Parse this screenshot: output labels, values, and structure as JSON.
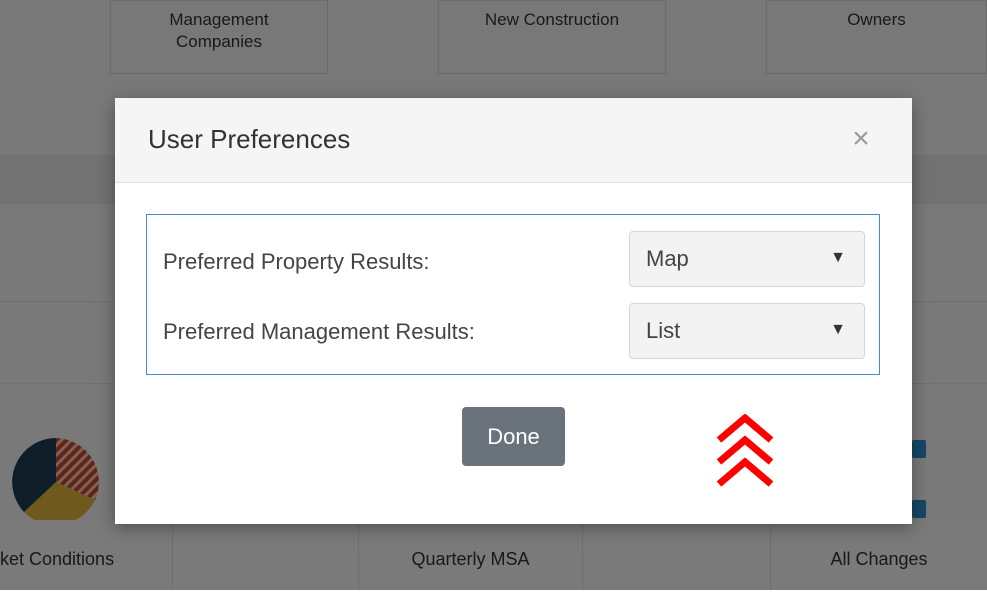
{
  "background": {
    "top_tiles": [
      {
        "line1": "Management",
        "line2": "Companies"
      },
      {
        "line1": "New Construction",
        "line2": ""
      },
      {
        "line1": "Owners",
        "line2": ""
      }
    ],
    "bottom_tiles": [
      "ket Conditions",
      "Quarterly MSA",
      "All Changes"
    ],
    "icons": {
      "pie": "pie-chart-icon",
      "app": "app-icon"
    }
  },
  "modal": {
    "title": "User Preferences",
    "close_symbol": "×",
    "preferences": [
      {
        "label": "Preferred Property Results:",
        "value": "Map"
      },
      {
        "label": "Preferred Management Results:",
        "value": "List"
      }
    ],
    "select_arrow": "▼",
    "done_label": "Done"
  },
  "colors": {
    "accent_border": "#3a8fd6",
    "done_button": "#6a737c",
    "indicator": "#ff0000"
  }
}
